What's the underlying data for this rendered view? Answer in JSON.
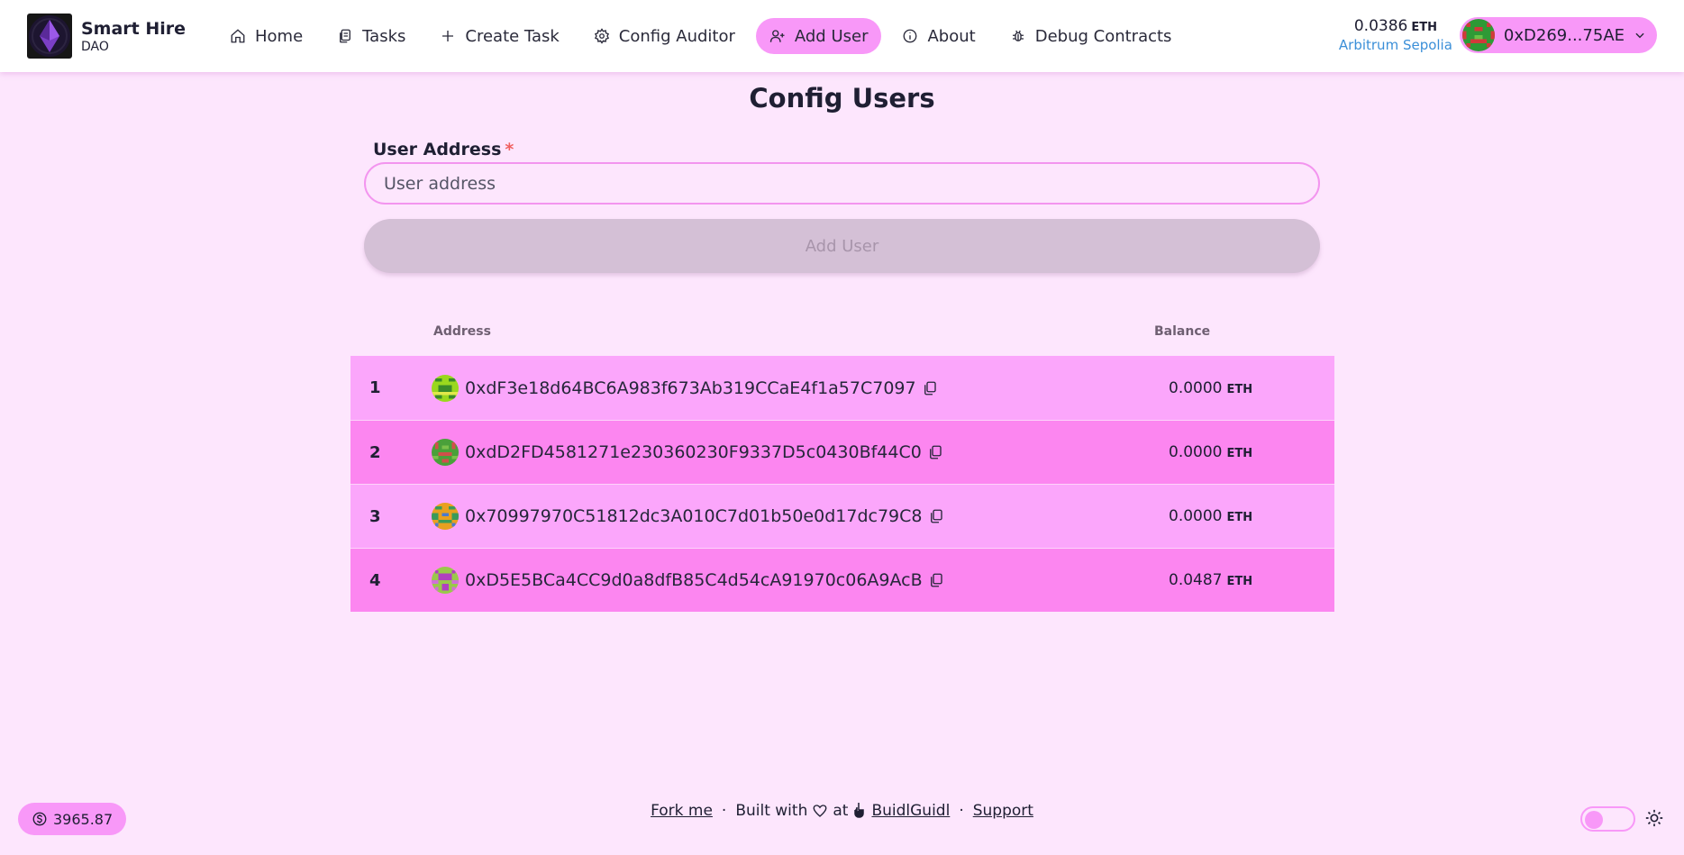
{
  "header": {
    "brand_title": "Smart Hire",
    "brand_sub": "DAO",
    "nav": [
      {
        "label": "Home",
        "icon": "home-icon"
      },
      {
        "label": "Tasks",
        "icon": "documents-icon"
      },
      {
        "label": "Create Task",
        "icon": "plus-icon"
      },
      {
        "label": "Config Auditor",
        "icon": "gear-icon"
      },
      {
        "label": "Add User",
        "icon": "user-plus-icon",
        "active": true
      },
      {
        "label": "About",
        "icon": "info-icon"
      },
      {
        "label": "Debug Contracts",
        "icon": "bug-icon"
      }
    ],
    "wallet_balance": "0.0386",
    "wallet_unit": "ETH",
    "network": "Arbitrum Sepolia",
    "account": "0xD269...75AE"
  },
  "main": {
    "title": "Config Users",
    "field_label": "User Address",
    "field_required_mark": "*",
    "input_placeholder": "User address",
    "input_value": "",
    "add_button_label": "Add User",
    "table": {
      "headers": {
        "address": "Address",
        "balance": "Balance"
      },
      "rows": [
        {
          "index": "1",
          "address": "0xdF3e18d64BC6A983f673Ab319CCaE4f1a57C7097",
          "balance": "0.0000",
          "unit": "ETH"
        },
        {
          "index": "2",
          "address": "0xdD2FD4581271e230360230F9337D5c0430Bf44C0",
          "balance": "0.0000",
          "unit": "ETH"
        },
        {
          "index": "3",
          "address": "0x70997970C51812dc3A010C7d01b50e0d17dc79C8",
          "balance": "0.0000",
          "unit": "ETH"
        },
        {
          "index": "4",
          "address": "0xD5E5BCa4CC9d0a8dfB85C4d54cA91970c06A9AcB",
          "balance": "0.0487",
          "unit": "ETH"
        }
      ]
    }
  },
  "footer": {
    "price": "3965.87",
    "fork_me": "Fork me",
    "sep": "·",
    "built_with": "Built with",
    "at": "at",
    "buidlguidl": "BuidlGuidl",
    "support": "Support"
  },
  "colors": {
    "background": "#fde6fd",
    "accent": "#f898f8",
    "row_light": "#fba6fb",
    "row_dark": "#fc86f0",
    "network": "#3b8fd8"
  }
}
